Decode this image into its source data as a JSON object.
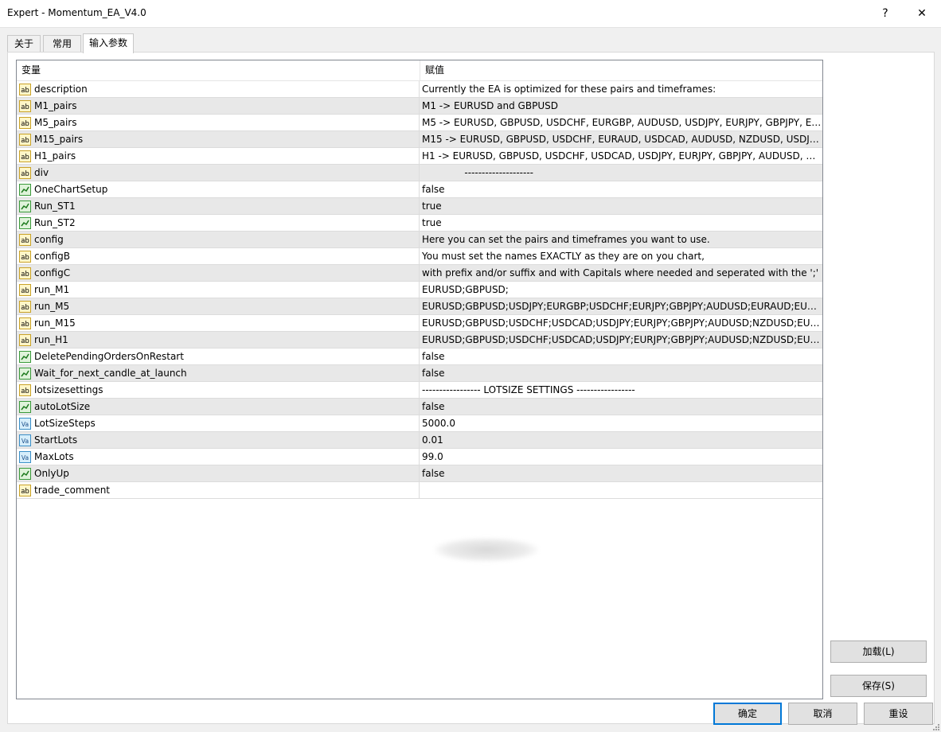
{
  "window": {
    "title": "Expert - Momentum_EA_V4.0",
    "help_label": "?",
    "close_label": "✕"
  },
  "tabs": [
    {
      "label": "关于"
    },
    {
      "label": "常用"
    },
    {
      "label": "输入参数"
    }
  ],
  "grid": {
    "col_variable": "变量",
    "col_value": "赋值",
    "rows": [
      {
        "type": "string",
        "name": "description",
        "value": "Currently the EA is optimized for these pairs and timeframes:"
      },
      {
        "type": "string",
        "name": "M1_pairs",
        "value": "M1 -> EURUSD and GBPUSD"
      },
      {
        "type": "string",
        "name": "M5_pairs",
        "value": "M5 -> EURUSD, GBPUSD, USDCHF, EURGBP, AUDUSD, USDJPY, EURJPY, GBPJPY, EU..."
      },
      {
        "type": "string",
        "name": "M15_pairs",
        "value": "M15 -> EURUSD, GBPUSD, USDCHF, EURAUD, USDCAD, AUDUSD, NZDUSD, USDJPY..."
      },
      {
        "type": "string",
        "name": "H1_pairs",
        "value": "H1 -> EURUSD, GBPUSD, USDCHF, USDCAD, USDJPY, EURJPY, GBPJPY, AUDUSD, NZ..."
      },
      {
        "type": "string",
        "name": "div",
        "value": "              --------------------"
      },
      {
        "type": "bool",
        "name": "OneChartSetup",
        "value": "false"
      },
      {
        "type": "bool",
        "name": "Run_ST1",
        "value": "true"
      },
      {
        "type": "bool",
        "name": "Run_ST2",
        "value": "true"
      },
      {
        "type": "string",
        "name": "config",
        "value": "Here you can set the pairs and timeframes you want to use."
      },
      {
        "type": "string",
        "name": "configB",
        "value": "You must set the names EXACTLY as they are on you chart,"
      },
      {
        "type": "string",
        "name": "configC",
        "value": "with prefix and/or suffix and with Capitals where needed and seperated with the ';'"
      },
      {
        "type": "string",
        "name": "run_M1",
        "value": "EURUSD;GBPUSD;"
      },
      {
        "type": "string",
        "name": "run_M5",
        "value": "EURUSD;GBPUSD;USDJPY;EURGBP;USDCHF;EURJPY;GBPJPY;AUDUSD;EURAUD;EURC..."
      },
      {
        "type": "string",
        "name": "run_M15",
        "value": "EURUSD;GBPUSD;USDCHF;USDCAD;USDJPY;EURJPY;GBPJPY;AUDUSD;NZDUSD;EURA..."
      },
      {
        "type": "string",
        "name": "run_H1",
        "value": "EURUSD;GBPUSD;USDCHF;USDCAD;USDJPY;EURJPY;GBPJPY;AUDUSD;NZDUSD;EURA..."
      },
      {
        "type": "bool",
        "name": "DeletePendingOrdersOnRestart",
        "value": "false"
      },
      {
        "type": "bool",
        "name": "Wait_for_next_candle_at_launch",
        "value": "false"
      },
      {
        "type": "string",
        "name": "lotsizesettings",
        "value": "----------------- LOTSIZE SETTINGS -----------------"
      },
      {
        "type": "bool",
        "name": "autoLotSize",
        "value": "false"
      },
      {
        "type": "number",
        "name": "LotSizeSteps",
        "value": "5000.0"
      },
      {
        "type": "number",
        "name": "StartLots",
        "value": "0.01"
      },
      {
        "type": "number",
        "name": "MaxLots",
        "value": "99.0"
      },
      {
        "type": "bool",
        "name": "OnlyUp",
        "value": "false"
      },
      {
        "type": "string",
        "name": "trade_comment",
        "value": ""
      }
    ]
  },
  "icons": {
    "string": "ab",
    "number": "Va",
    "bool": "bool-chart-icon"
  },
  "buttons": {
    "load": "加载(L)",
    "save": "保存(S)",
    "ok": "确定",
    "cancel": "取消",
    "reset": "重设"
  },
  "colors": {
    "default_button_border": "#0078d7",
    "alt_row": "#e8e8e8"
  }
}
